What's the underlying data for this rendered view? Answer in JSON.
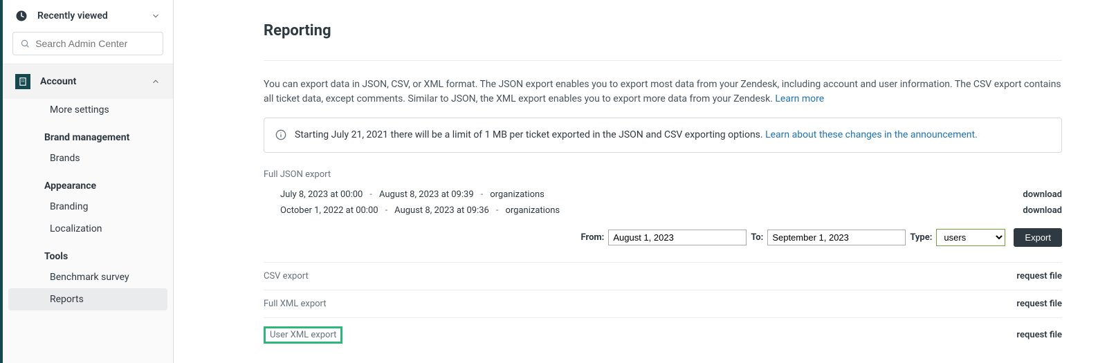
{
  "sidebar": {
    "recently_viewed": "Recently viewed",
    "search_placeholder": "Search Admin Center",
    "account_label": "Account",
    "items": {
      "more_settings": "More settings",
      "brand_management_heading": "Brand management",
      "brands": "Brands",
      "appearance_heading": "Appearance",
      "branding": "Branding",
      "localization": "Localization",
      "tools_heading": "Tools",
      "benchmark_survey": "Benchmark survey",
      "reports": "Reports"
    }
  },
  "page_title": "Reporting",
  "intro_text": "You can export data in JSON, CSV, or XML format. The JSON export enables you to export most data from your Zendesk, including account and user information. The CSV export contains all ticket data, except comments. Similar to JSON, the XML export enables you to export more data from your Zendesk. ",
  "learn_more": "Learn more",
  "notice_text": "Starting July 21, 2021 there will be a limit of 1 MB per ticket exported in the JSON and CSV exporting options. ",
  "notice_link": "Learn about these changes in the announcement.",
  "json_export_title": "Full JSON export",
  "json_exports": [
    {
      "from": "July 8, 2023 at 00:00",
      "to": "August 8, 2023 at 09:39",
      "type": "organizations",
      "action": "download"
    },
    {
      "from": "October 1, 2022 at 00:00",
      "to": "August 8, 2023 at 09:36",
      "type": "organizations",
      "action": "download"
    }
  ],
  "filter": {
    "from_label": "From:",
    "from_value": "August 1, 2023",
    "to_label": "To:",
    "to_value": "September 1, 2023",
    "type_label": "Type:",
    "type_value": "users",
    "export_btn": "Export"
  },
  "sections": {
    "csv": {
      "name": "CSV export",
      "action": "request file"
    },
    "xml": {
      "name": "Full XML export",
      "action": "request file"
    },
    "user_xml": {
      "name": "User XML export",
      "action": "request file"
    }
  }
}
